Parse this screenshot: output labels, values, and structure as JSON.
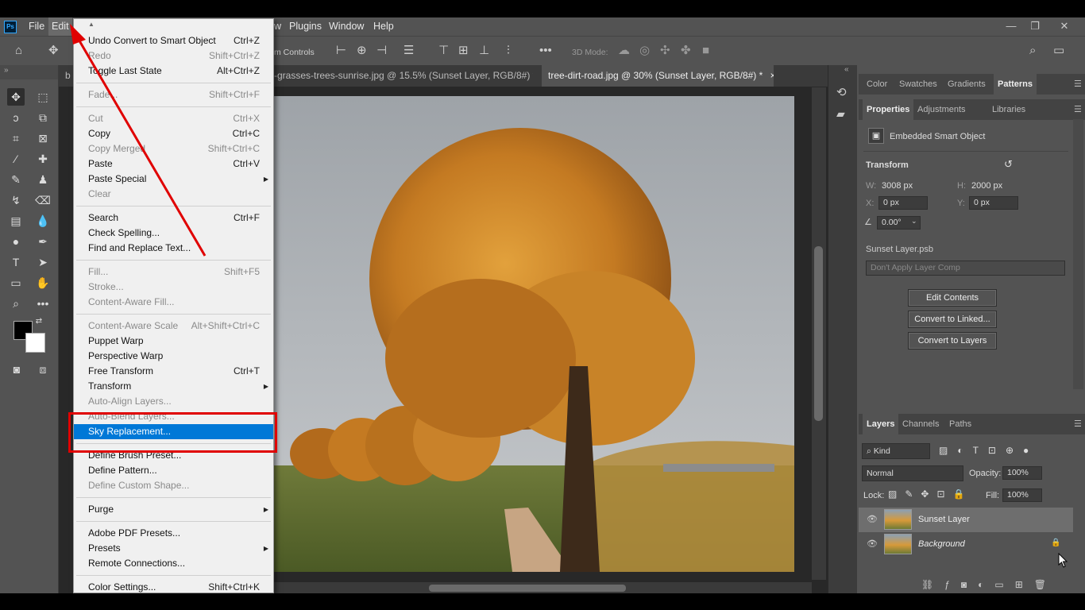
{
  "menubar": {
    "app_icon": "Ps",
    "items": [
      "File",
      "Edit",
      "Plugins",
      "Window",
      "Help"
    ],
    "partial_item": "w"
  },
  "options_bar": {
    "show_transform_partial": "m Controls",
    "mode3d": "3D Mode:"
  },
  "tabs": [
    {
      "label": "b",
      "active": false
    },
    {
      "label": "-grasses-trees-sunrise.jpg @ 15.5% (Sunset Layer, RGB/8#) *",
      "active": false,
      "close": "×"
    },
    {
      "label": "tree-dirt-road.jpg @ 30% (Sunset Layer, RGB/8#) *",
      "active": true,
      "close": "×"
    }
  ],
  "edit_menu": {
    "items": [
      {
        "label": "Undo Convert to Smart Object",
        "shortcut": "Ctrl+Z",
        "enabled": true
      },
      {
        "label": "Redo",
        "shortcut": "Shift+Ctrl+Z",
        "enabled": false
      },
      {
        "label": "Toggle Last State",
        "shortcut": "Alt+Ctrl+Z",
        "enabled": true
      },
      {
        "sep": true
      },
      {
        "label": "Fade...",
        "shortcut": "Shift+Ctrl+F",
        "enabled": false
      },
      {
        "sep": true
      },
      {
        "label": "Cut",
        "shortcut": "Ctrl+X",
        "enabled": false
      },
      {
        "label": "Copy",
        "shortcut": "Ctrl+C",
        "enabled": true
      },
      {
        "label": "Copy Merged",
        "shortcut": "Shift+Ctrl+C",
        "enabled": false
      },
      {
        "label": "Paste",
        "shortcut": "Ctrl+V",
        "enabled": true
      },
      {
        "label": "Paste Special",
        "shortcut": "",
        "enabled": true,
        "submenu": true
      },
      {
        "label": "Clear",
        "shortcut": "",
        "enabled": false
      },
      {
        "sep": true
      },
      {
        "label": "Search",
        "shortcut": "Ctrl+F",
        "enabled": true
      },
      {
        "label": "Check Spelling...",
        "shortcut": "",
        "enabled": true
      },
      {
        "label": "Find and Replace Text...",
        "shortcut": "",
        "enabled": true
      },
      {
        "sep": true
      },
      {
        "label": "Fill...",
        "shortcut": "Shift+F5",
        "enabled": false
      },
      {
        "label": "Stroke...",
        "shortcut": "",
        "enabled": false
      },
      {
        "label": "Content-Aware Fill...",
        "shortcut": "",
        "enabled": false
      },
      {
        "sep": true
      },
      {
        "label": "Content-Aware Scale",
        "shortcut": "Alt+Shift+Ctrl+C",
        "enabled": false
      },
      {
        "label": "Puppet Warp",
        "shortcut": "",
        "enabled": true
      },
      {
        "label": "Perspective Warp",
        "shortcut": "",
        "enabled": true
      },
      {
        "label": "Free Transform",
        "shortcut": "Ctrl+T",
        "enabled": true
      },
      {
        "label": "Transform",
        "shortcut": "",
        "enabled": true,
        "submenu": true
      },
      {
        "label": "Auto-Align Layers...",
        "shortcut": "",
        "enabled": false
      },
      {
        "label": "Auto-Blend Layers...",
        "shortcut": "",
        "enabled": false
      },
      {
        "label": "Sky Replacement...",
        "shortcut": "",
        "enabled": true,
        "highlight": true
      },
      {
        "sep": true
      },
      {
        "label": "Define Brush Preset...",
        "shortcut": "",
        "enabled": true
      },
      {
        "label": "Define Pattern...",
        "shortcut": "",
        "enabled": true
      },
      {
        "label": "Define Custom Shape...",
        "shortcut": "",
        "enabled": false
      },
      {
        "sep": true
      },
      {
        "label": "Purge",
        "shortcut": "",
        "enabled": true,
        "submenu": true
      },
      {
        "sep": true
      },
      {
        "label": "Adobe PDF Presets...",
        "shortcut": "",
        "enabled": true
      },
      {
        "label": "Presets",
        "shortcut": "",
        "enabled": true,
        "submenu": true
      },
      {
        "label": "Remote Connections...",
        "shortcut": "",
        "enabled": true
      },
      {
        "sep": true
      },
      {
        "label": "Color Settings...",
        "shortcut": "Shift+Ctrl+K",
        "enabled": true
      }
    ]
  },
  "top_panel_tabs": [
    "Color",
    "Swatches",
    "Gradients",
    "Patterns"
  ],
  "properties_tabs": [
    "Properties",
    "Adjustments",
    "Libraries"
  ],
  "properties": {
    "object_type": "Embedded Smart Object",
    "transform_title": "Transform",
    "w_label": "W:",
    "w_value": "3008 px",
    "h_label": "H:",
    "h_value": "2000 px",
    "x_label": "X:",
    "x_value": "0 px",
    "y_label": "Y:",
    "y_value": "0 px",
    "angle_value": "0.00°",
    "psb_name": "Sunset Layer.psb",
    "layer_comp": "Don't Apply Layer Comp",
    "buttons": [
      "Edit Contents",
      "Convert to Linked...",
      "Convert to Layers"
    ]
  },
  "layers_tabs": [
    "Layers",
    "Channels",
    "Paths"
  ],
  "layers_panel": {
    "filter_kind": "Kind",
    "blend_mode": "Normal",
    "opacity_label": "Opacity:",
    "opacity": "100%",
    "lock_label": "Lock:",
    "fill_label": "Fill:",
    "fill": "100%",
    "layers": [
      {
        "name": "Sunset Layer",
        "selected": true,
        "smart": true
      },
      {
        "name": "Background",
        "selected": false,
        "locked": true
      }
    ]
  },
  "colors": {
    "menu_highlight": "#0078d7",
    "annotation_red": "#e00000",
    "ps_panel": "#535353"
  }
}
